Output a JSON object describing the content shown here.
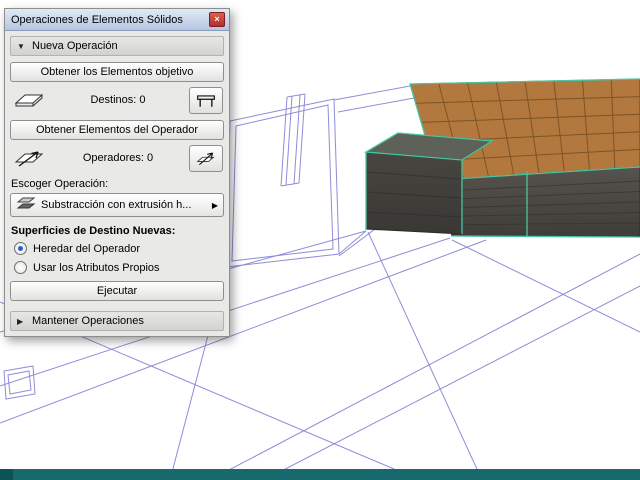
{
  "window": {
    "title": "Operaciones de Elementos Sólidos"
  },
  "icons": {
    "close": "×",
    "collapse": "▼",
    "expand": "▶",
    "menu_arrow": "▶"
  },
  "sections": {
    "nueva": "Nueva Operación",
    "mantener": "Mantener Operaciones"
  },
  "buttons": {
    "get_targets": "Obtener los Elementos objetivo",
    "get_operators": "Obtener Elementos del Operador",
    "execute": "Ejecutar"
  },
  "counts": {
    "targets": "Destinos: 0",
    "operators": "Operadores: 0"
  },
  "labels": {
    "choose_operation": "Escoger Operación:",
    "new_target_surfaces": "Superficies de Destino Nuevas:"
  },
  "operation": {
    "selected": "Substracción con extrusión h..."
  },
  "radios": [
    {
      "label": "Heredar del Operador",
      "selected": true
    },
    {
      "label": "Usar los Atributos Propios",
      "selected": false
    }
  ],
  "colors": {
    "titlebar": "#b6c6e0",
    "close_red": "#b02e2e",
    "wireframe_blue": "#8d8dd8",
    "selection_teal": "#46c6a2",
    "tile_brown": "#b3783d",
    "concrete_gray": "#4b4946",
    "statusbar_teal": "#17696b"
  }
}
